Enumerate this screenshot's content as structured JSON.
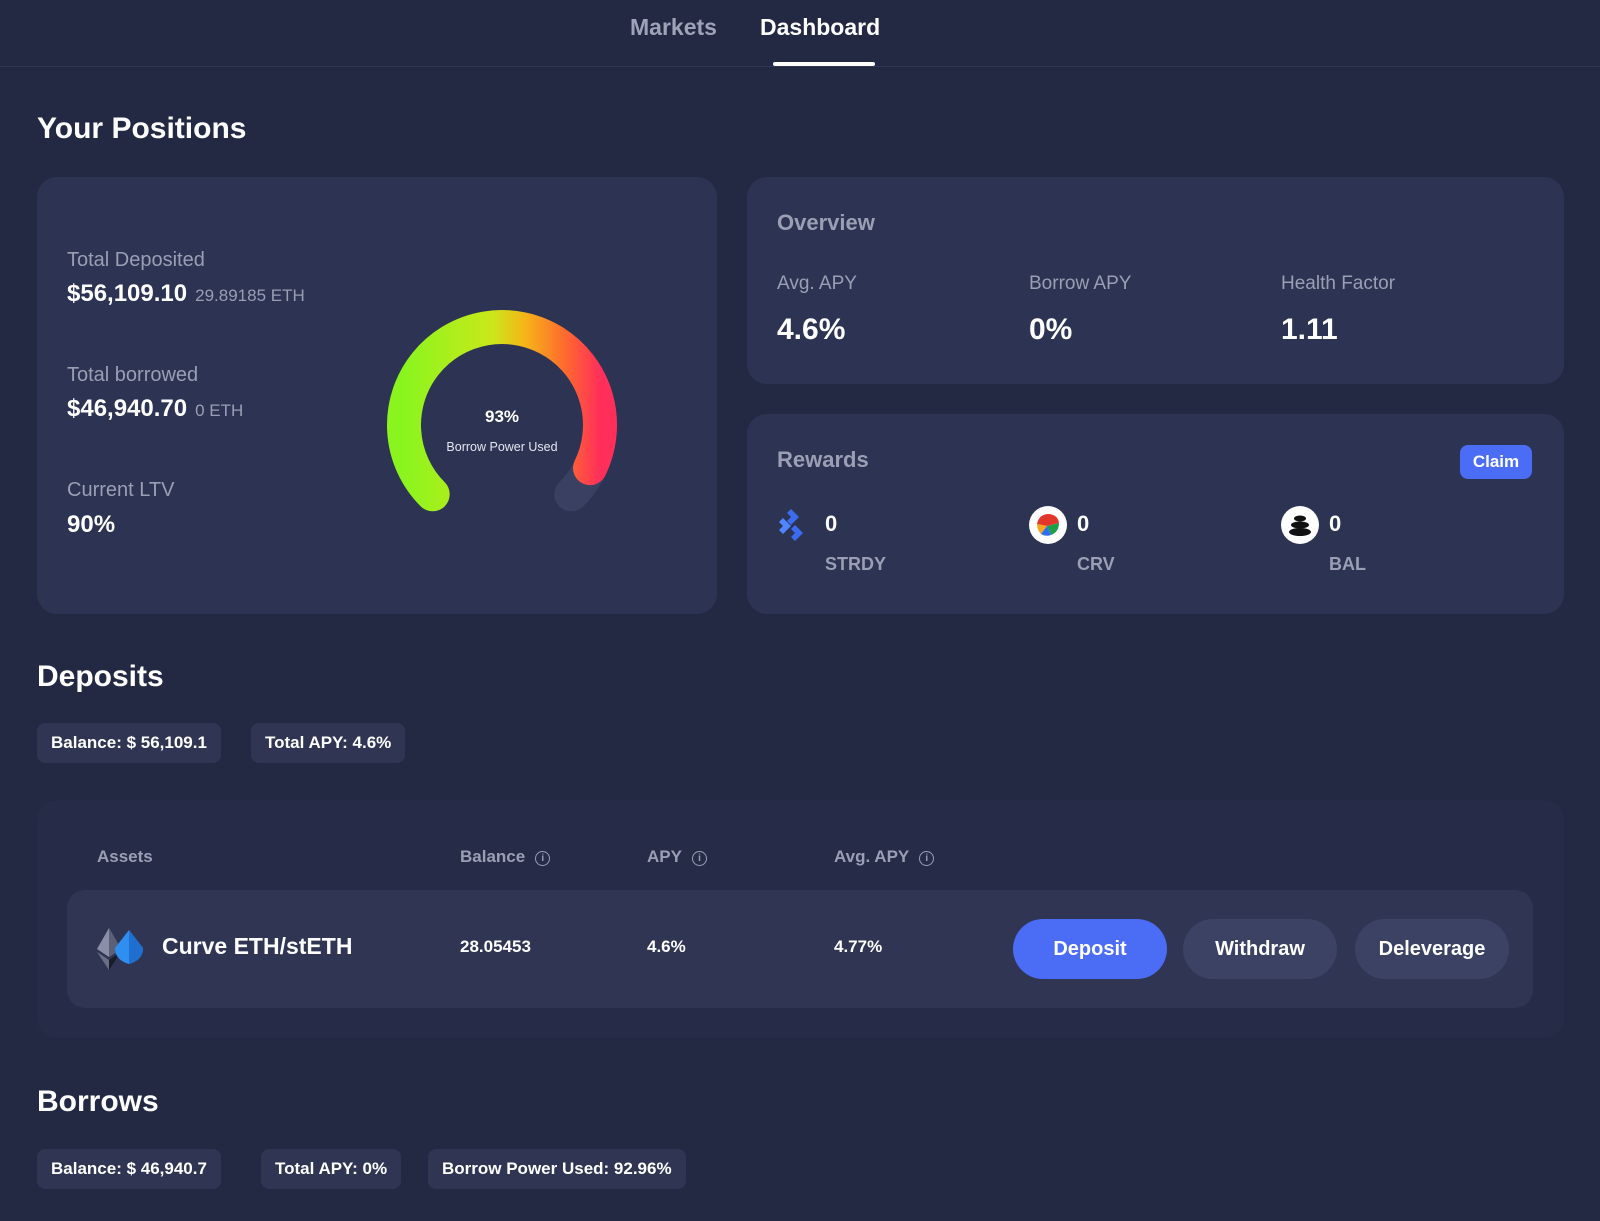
{
  "nav": {
    "tabs": [
      {
        "label": "Markets"
      },
      {
        "label": "Dashboard"
      }
    ]
  },
  "positions": {
    "title": "Your Positions",
    "total_deposited": {
      "label": "Total Deposited",
      "value": "$56,109.10",
      "sub": "29.89185 ETH"
    },
    "total_borrowed": {
      "label": "Total borrowed",
      "value": "$46,940.70",
      "sub": "0 ETH"
    },
    "current_ltv": {
      "label": "Current LTV",
      "value": "90%"
    },
    "gauge": {
      "percent_text": "93%",
      "label": "Borrow Power Used",
      "fraction": 0.93
    }
  },
  "overview": {
    "title": "Overview",
    "stats": [
      {
        "label": "Avg. APY",
        "value": "4.6%"
      },
      {
        "label": "Borrow APY",
        "value": "0%"
      },
      {
        "label": "Health Factor",
        "value": "1.11"
      }
    ]
  },
  "rewards": {
    "title": "Rewards",
    "claim_label": "Claim",
    "items": [
      {
        "amount": "0",
        "symbol": "STRDY",
        "icon": "strdy-icon"
      },
      {
        "amount": "0",
        "symbol": "CRV",
        "icon": "crv-icon"
      },
      {
        "amount": "0",
        "symbol": "BAL",
        "icon": "bal-icon"
      }
    ]
  },
  "deposits": {
    "title": "Deposits",
    "balance_pill": "Balance: $ 56,109.1",
    "apy_pill": "Total APY: 4.6%",
    "columns": [
      "Assets",
      "Balance",
      "APY",
      "Avg. APY"
    ],
    "rows": [
      {
        "asset": "Curve ETH/stETH",
        "balance": "28.05453",
        "apy": "4.6%",
        "avg_apy": "4.77%",
        "actions": [
          "Deposit",
          "Withdraw",
          "Deleverage"
        ]
      }
    ]
  },
  "borrows": {
    "title": "Borrows",
    "balance_pill": "Balance: $ 46,940.7",
    "apy_pill": "Total APY: 0%",
    "power_pill": "Borrow Power Used: 92.96%"
  },
  "colors": {
    "background": "#232943",
    "card": "#2d3352",
    "accent": "#4b6cf5",
    "gauge_start": "#8af51e",
    "gauge_end": "#ff3d52"
  }
}
